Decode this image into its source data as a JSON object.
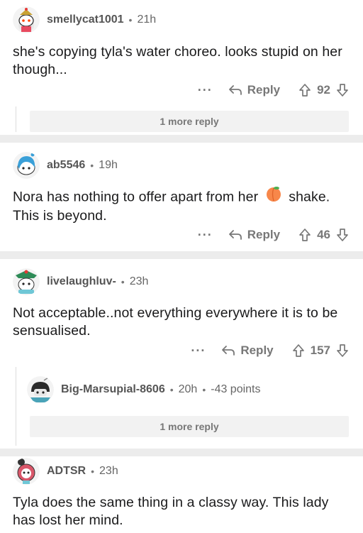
{
  "comments": [
    {
      "username": "smellycat1001",
      "time": "21h",
      "text": "she's copying tyla's water choreo. looks stupid on her though...",
      "reply": "Reply",
      "score": "92",
      "more_label": "···",
      "more_replies": "1 more reply"
    },
    {
      "username": "ab5546",
      "time": "19h",
      "text_before": "Nora has nothing to offer apart from her",
      "text_after": "shake. This is beyond.",
      "emoji": "peach-emoji",
      "reply": "Reply",
      "score": "46",
      "more_label": "···"
    },
    {
      "username": "livelaughluv-",
      "time": "23h",
      "text": "Not acceptable..not everything everywhere it is to be sensualised.",
      "reply": "Reply",
      "score": "157",
      "more_label": "···",
      "child": {
        "username": "Big-Marsupial-8606",
        "time": "20h",
        "points": "-43 points"
      },
      "more_replies": "1 more reply"
    },
    {
      "username": "ADTSR",
      "time": "23h",
      "text": "Tyla does the same thing in a classy way. This lady has lost her mind."
    }
  ],
  "icons": {
    "reply": "reply-arrow-icon",
    "upvote": "upvote-arrow-icon",
    "downvote": "downvote-arrow-icon"
  }
}
